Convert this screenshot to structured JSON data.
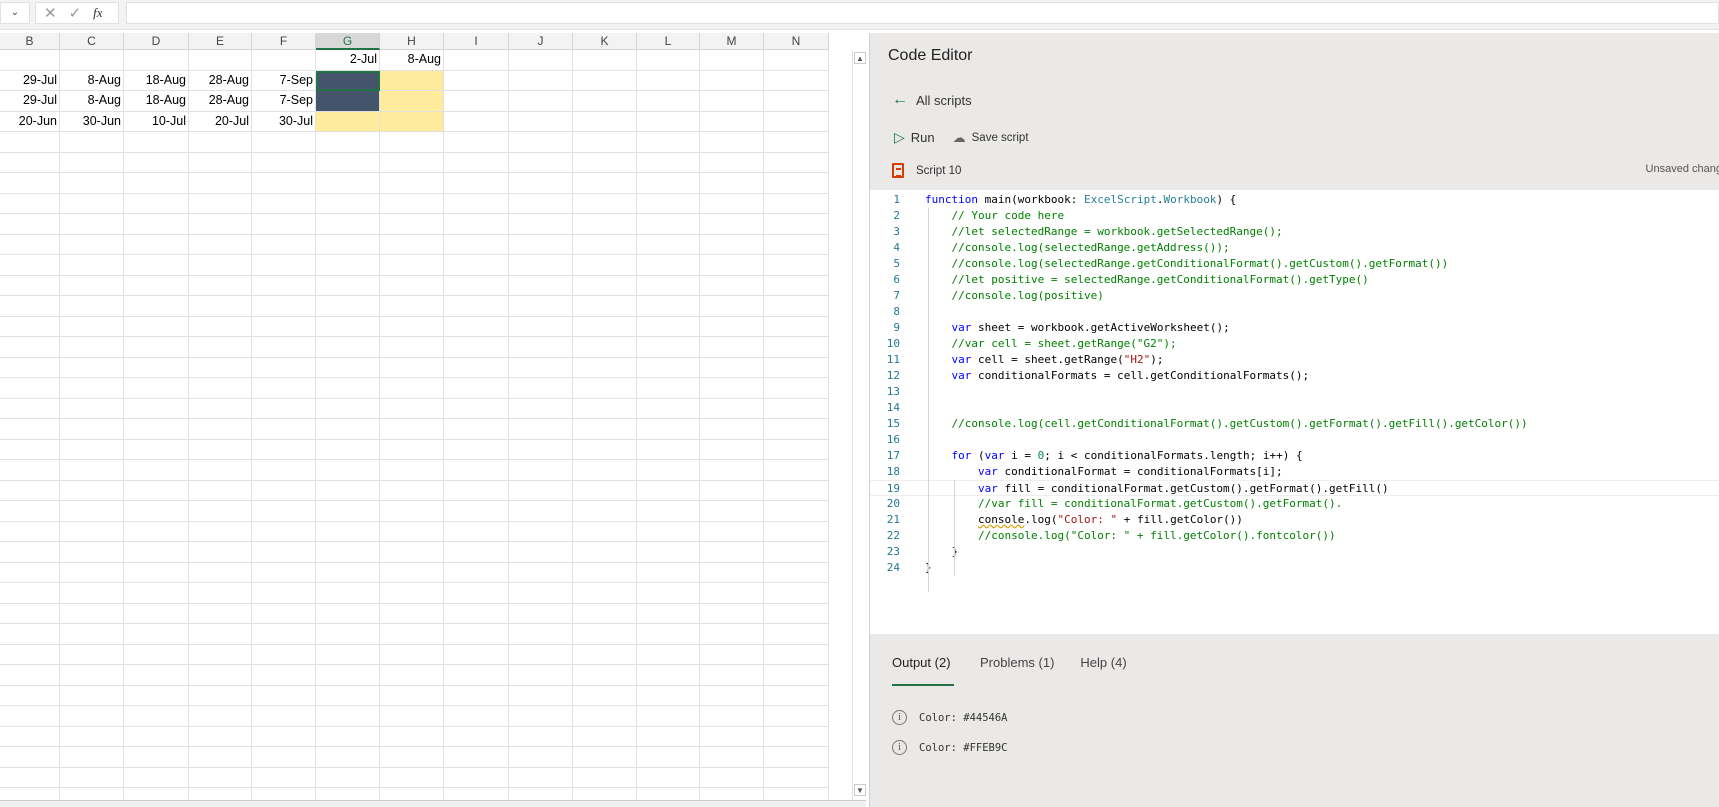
{
  "formula_bar": {
    "name_box_icon": "chevron-down",
    "cancel": "✕",
    "confirm": "✓",
    "fx": "fx",
    "value": ""
  },
  "grid": {
    "columns": [
      "B",
      "C",
      "D",
      "E",
      "F",
      "G",
      "H",
      "I",
      "J",
      "K",
      "L",
      "M",
      "N"
    ],
    "selected_column": "G",
    "rows": [
      [
        "",
        "",
        "",
        "",
        "",
        "2-Jul",
        "8-Aug",
        "",
        "",
        "",
        "",
        "",
        ""
      ],
      [
        "29-Jul",
        "8-Aug",
        "18-Aug",
        "28-Aug",
        "7-Sep",
        "",
        "",
        "",
        "",
        "",
        "",
        "",
        ""
      ],
      [
        "29-Jul",
        "8-Aug",
        "18-Aug",
        "28-Aug",
        "7-Sep",
        "",
        "",
        "",
        "",
        "",
        "",
        "",
        ""
      ],
      [
        "20-Jun",
        "30-Jun",
        "10-Jul",
        "20-Jul",
        "30-Jul",
        "",
        "",
        "",
        "",
        "",
        "",
        "",
        ""
      ]
    ],
    "fills": {
      "dark": "#44546A",
      "yellow": "#FFEB9C",
      "accent": "#217346"
    }
  },
  "panel": {
    "title": "Code Editor",
    "back_label": "All scripts",
    "run_label": "Run",
    "save_label": "Save script",
    "script_name": "Script 10",
    "status": "Unsaved chang",
    "code": [
      "function main(workbook: ExcelScript.Workbook) {",
      "    // Your code here",
      "    //let selectedRange = workbook.getSelectedRange();",
      "    //console.log(selectedRange.getAddress());",
      "    //console.log(selectedRange.getConditionalFormat().getCustom().getFormat())",
      "    //let positive = selectedRange.getConditionalFormat().getType()",
      "    //console.log(positive)",
      "",
      "    var sheet = workbook.getActiveWorksheet();",
      "    //var cell = sheet.getRange(\"G2\");",
      "    var cell = sheet.getRange(\"H2\");",
      "    var conditionalFormats = cell.getConditionalFormats();",
      "",
      "",
      "    //console.log(cell.getConditionalFormat().getCustom().getFormat().getFill().getColor())",
      "",
      "    for (var i = 0; i < conditionalFormats.length; i++) {",
      "        var conditionalFormat = conditionalFormats[i];",
      "        var fill = conditionalFormat.getCustom().getFormat().getFill()",
      "        //var fill = conditionalFormat.getCustom().getFormat().",
      "        console.log(\"Color: \" + fill.getColor())",
      "        //console.log(\"Color: \" + fill.getColor().fontcolor())",
      "    }",
      "}"
    ],
    "tabs": [
      {
        "label": "Output (2)",
        "active": true
      },
      {
        "label": "Problems (1)",
        "active": false
      },
      {
        "label": "Help (4)",
        "active": false
      }
    ],
    "output": [
      "Color: #44546A",
      "Color: #FFEB9C"
    ]
  }
}
